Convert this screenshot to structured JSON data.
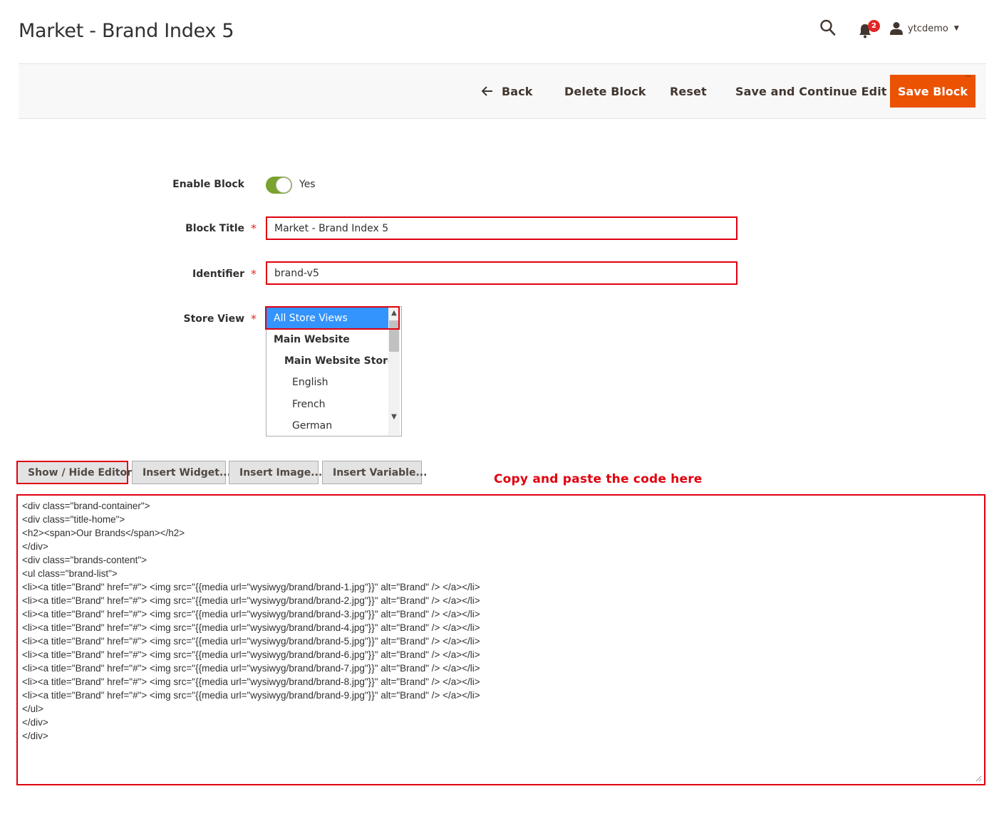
{
  "header": {
    "title": "Market - Brand Index 5",
    "notifications_count": "2",
    "user_name": "ytcdemo"
  },
  "actions": {
    "back": "Back",
    "delete": "Delete Block",
    "reset": "Reset",
    "save_continue": "Save and Continue Edit",
    "save": "Save Block"
  },
  "form": {
    "enable_label": "Enable Block",
    "enable_value": "Yes",
    "title_label": "Block Title",
    "title_value": "Market - Brand Index 5",
    "identifier_label": "Identifier",
    "identifier_value": "brand-v5",
    "store_view_label": "Store View",
    "store_options": [
      {
        "label": "All Store Views"
      },
      {
        "label": "Main Website"
      },
      {
        "label": "Main Website Store"
      },
      {
        "label": "English"
      },
      {
        "label": "French"
      },
      {
        "label": "German"
      }
    ]
  },
  "editor": {
    "show_hide": "Show / Hide Editor",
    "insert_widget": "Insert Widget...",
    "insert_image": "Insert Image...",
    "insert_variable": "Insert Variable...",
    "note": "Copy and paste the code here",
    "code_lines": [
      "<div class=\"brand-container\">",
      "<div class=\"title-home\">",
      "<h2><span>Our Brands</span></h2>",
      "</div>",
      "<div class=\"brands-content\">",
      "<ul class=\"brand-list\">",
      "<li><a title=\"Brand\" href=\"#\"> <img src=\"{{media url=\"wysiwyg/brand/brand-1.jpg\"}}\" alt=\"Brand\" /> </a></li>",
      "<li><a title=\"Brand\" href=\"#\"> <img src=\"{{media url=\"wysiwyg/brand/brand-2.jpg\"}}\" alt=\"Brand\" /> </a></li>",
      "<li><a title=\"Brand\" href=\"#\"> <img src=\"{{media url=\"wysiwyg/brand/brand-3.jpg\"}}\" alt=\"Brand\" /> </a></li>",
      "<li><a title=\"Brand\" href=\"#\"> <img src=\"{{media url=\"wysiwyg/brand/brand-4.jpg\"}}\" alt=\"Brand\" /> </a></li>",
      "<li><a title=\"Brand\" href=\"#\"> <img src=\"{{media url=\"wysiwyg/brand/brand-5.jpg\"}}\" alt=\"Brand\" /> </a></li>",
      "<li><a title=\"Brand\" href=\"#\"> <img src=\"{{media url=\"wysiwyg/brand/brand-6.jpg\"}}\" alt=\"Brand\" /> </a></li>",
      "<li><a title=\"Brand\" href=\"#\"> <img src=\"{{media url=\"wysiwyg/brand/brand-7.jpg\"}}\" alt=\"Brand\" /> </a></li>",
      "<li><a title=\"Brand\" href=\"#\"> <img src=\"{{media url=\"wysiwyg/brand/brand-8.jpg\"}}\" alt=\"Brand\" /> </a></li>",
      "<li><a title=\"Brand\" href=\"#\"> <img src=\"{{media url=\"wysiwyg/brand/brand-9.jpg\"}}\" alt=\"Brand\" /> </a></li>",
      "</ul>",
      "</div>",
      "</div>"
    ]
  },
  "colors": {
    "accent": "#eb5202",
    "highlight": "#e0000e",
    "toggle_on": "#79a22e",
    "selected_option": "#3394fd"
  },
  "icons": {
    "search": "search-icon",
    "bell": "bell-icon",
    "user": "user-icon",
    "back": "arrow-left-icon"
  }
}
